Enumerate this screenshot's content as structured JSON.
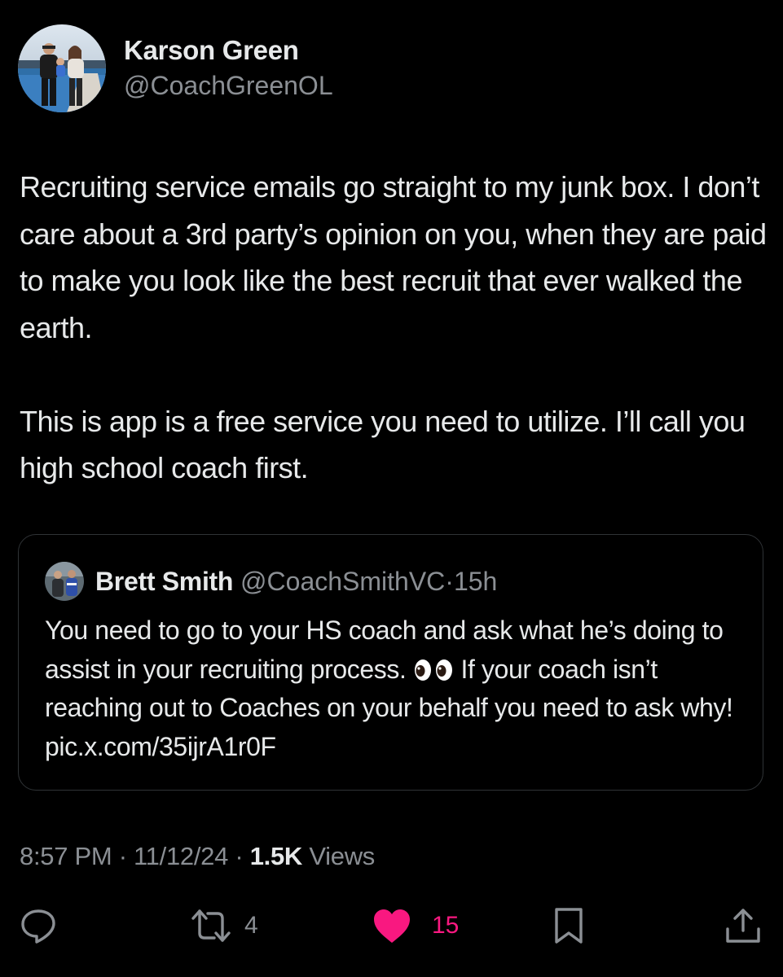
{
  "author": {
    "name": "Karson Green",
    "handle": "@CoachGreenOL"
  },
  "tweet": {
    "paragraphs": [
      "Recruiting service emails go straight to my junk box. I don’t care about a 3rd party’s opinion on you, when they are paid to make you look like the best recruit that ever walked the earth.",
      "This is app is a free service you need to utilize. I’ll call you high school coach first."
    ]
  },
  "quoted_tweet": {
    "name": "Brett Smith",
    "handle": "@CoachSmithVC",
    "separator": "·",
    "time": "15h",
    "text_before_emoji": "You need to go to your HS coach and ask what he’s doing to assist in your recruiting process.",
    "emoji": "eyes",
    "text_after_emoji": "If your coach isn’t reaching out to Coaches on your behalf you need to ask why! pic.x.com/35ijrA1r0F"
  },
  "meta": {
    "time": "8:57 PM",
    "separator": "·",
    "date": "11/12/24",
    "views_count": "1.5K",
    "views_label": "Views"
  },
  "actions": {
    "reply_icon": "speech-bubble-icon",
    "repost_icon": "repost-icon",
    "repost_count": "4",
    "like_icon": "heart-filled-icon",
    "like_count": "15",
    "bookmark_icon": "bookmark-icon",
    "share_icon": "share-icon"
  },
  "colors": {
    "background": "#000000",
    "text": "#e7e9ea",
    "secondary_text": "#8b8f94",
    "border": "#2f3336",
    "like": "#f91880"
  }
}
